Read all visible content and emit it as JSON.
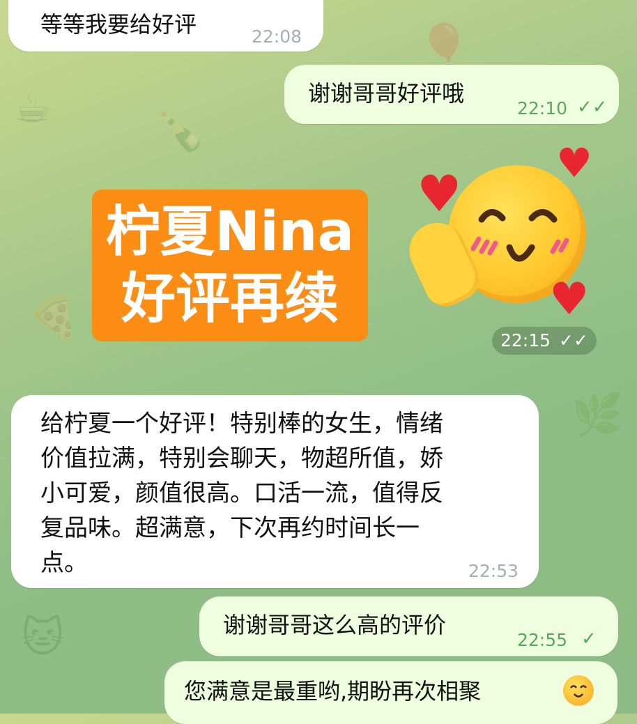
{
  "messages": [
    {
      "direction": "in",
      "text": "等等我要给好评",
      "time": "22:08"
    },
    {
      "direction": "out",
      "text": "谢谢哥哥好评哦",
      "time": "22:10",
      "status": "read"
    },
    {
      "direction": "out",
      "type": "sticker",
      "sticker_text": [
        "柠夏Nina",
        "好评再续"
      ],
      "time": "22:15",
      "status": "read"
    },
    {
      "direction": "in",
      "lines": [
        "给柠夏一个好评！特别棒的女生，情绪",
        "价值拉满，特别会聊天，物超所值，娇",
        "小可爱，颜值很高。口活一流，值得反",
        "复品味。超满意，下次再约时间长一",
        "点。"
      ],
      "time": "22:53"
    },
    {
      "direction": "out",
      "text": "谢谢哥哥这么高的评价",
      "time": "22:55",
      "status": "sent"
    },
    {
      "direction": "out",
      "text": "您满意是最重哟,期盼再次相聚",
      "emoji": "smiling-face-emoji"
    }
  ],
  "icons": {
    "read": "double-check-icon",
    "sent": "single-check-icon"
  },
  "colors": {
    "incoming_bubble": "#ffffff",
    "outgoing_bubble": "#eefedf",
    "sticker_orange": "#fb8c14",
    "check_green": "#5aa75c"
  }
}
